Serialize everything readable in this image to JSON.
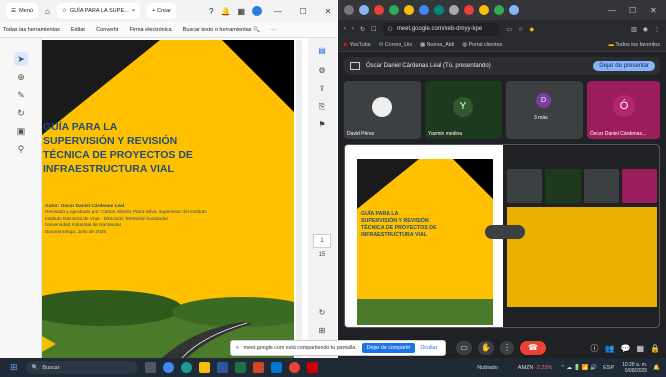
{
  "pdf_window": {
    "tab_menu": "Menú",
    "tab_title": "GUÍA PARA LA SUPE...",
    "new_tab": "+ Crear",
    "menu": [
      "Todas las herramientas",
      "Editar",
      "Convertir",
      "Firma electrónica",
      "Buscar texto o herramientas"
    ],
    "document": {
      "title_lines": [
        "GUÍA PARA LA",
        "SUPERVISIÓN Y REVISIÓN",
        "TÉCNICA DE PROYECTOS DE",
        "INFRAESTRUCTURA VIAL"
      ],
      "author": "Autor: Oscar Daniel Cárdenas Leal",
      "reviewed": "Revisado y aprobado por: Carlos Alberto Parra Silva, supervisor del Instituto",
      "institute": "Instituto Nacional de Vías - Dirección Territorial Santander",
      "university": "Universidad Industrial de Santander",
      "place_date": "Bucaramanga, Julio de 2025"
    },
    "page_numbers": [
      "1",
      "15"
    ]
  },
  "browser": {
    "url": "meet.google.com/xeb-dmyy-kpe",
    "bookmarks": [
      "YouTube",
      "Correo_Uis",
      "Nueva_Aldi",
      "Portal clientes",
      "Todos los favoritos"
    ],
    "meet": {
      "presenter_bar": "Óscar Daniel Cárdenas Leal (Tú, presentando)",
      "stop_presenting": "Dejar de presentar",
      "participants": [
        {
          "name": "David Pérez",
          "initial": "",
          "color": "#3c4043"
        },
        {
          "name": "Yazmin medina",
          "initial": "Y",
          "color": "#1e3a1e"
        },
        {
          "name": "3 más",
          "initial": "D",
          "color": "#3c4043"
        },
        {
          "name": "Óscar Daniel Cárdenas...",
          "initial": "Ó",
          "color": "#9c1d5c"
        }
      ],
      "share_notice": "meet.google.com está compartiendo tu pantalla.",
      "stop_share_button": "Dejar de compartir",
      "hide_button": "Ocultar"
    }
  },
  "taskbar": {
    "search": "Buscar",
    "stock": "AMZN",
    "stock_change": "-2,23%",
    "weather": "Nublado",
    "lang": "ESP",
    "time": "10:28 a. m.",
    "date": "5/08/2025"
  }
}
